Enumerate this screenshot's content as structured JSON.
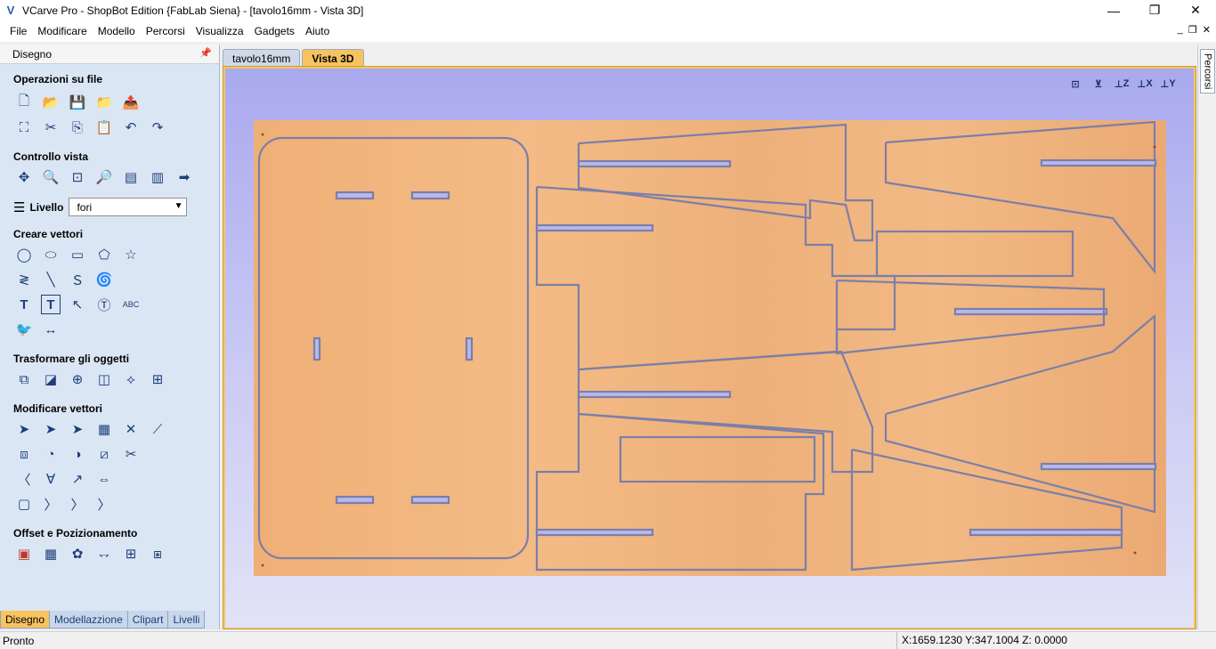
{
  "window": {
    "title": "VCarve Pro - ShopBot Edition {FabLab Siena} - [tavolo16mm - Vista 3D]",
    "controls": [
      "minimize-icon",
      "restore-icon",
      "close-icon"
    ]
  },
  "menu": {
    "items": [
      "File",
      "Modificare",
      "Modello",
      "Percorsi",
      "Visualizza",
      "Gadgets",
      "Aiuto"
    ]
  },
  "left_panel": {
    "header": "Disegno",
    "sections": {
      "file": "Operazioni su file",
      "view": "Controllo vista",
      "create": "Creare vettori",
      "transform": "Trasformare gli oggetti",
      "edit": "Modificare vettori",
      "offset": "Offset e Pozizionamento"
    },
    "layer": {
      "label": "Livello",
      "selected": "fori"
    },
    "bottom_tabs": [
      "Disegno",
      "Modellazzione",
      "Clipart",
      "Livelli"
    ]
  },
  "doc_tabs": [
    "tavolo16mm",
    "Vista 3D"
  ],
  "right_panel": {
    "tab": "Percorsi"
  },
  "view_tools": [
    "X",
    "Y",
    "Z",
    "X",
    "Y"
  ],
  "status": {
    "text": "Pronto",
    "coords": "X:1659.1230 Y:347.1004 Z:  0.0000"
  }
}
